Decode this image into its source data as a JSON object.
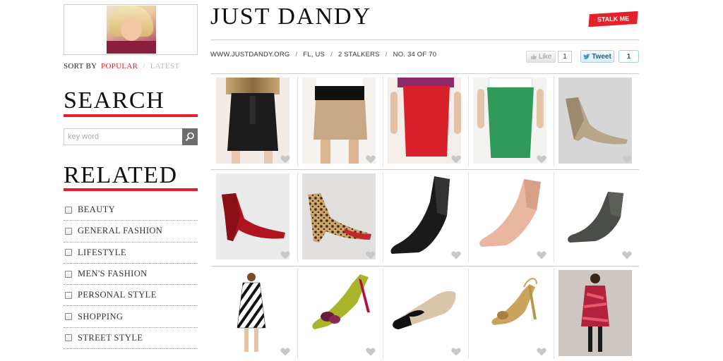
{
  "sidebar": {
    "sort_label": "SORT BY",
    "sort_popular": "POPULAR",
    "sort_sep": "/",
    "sort_latest": "LATEST",
    "search_heading": "SEARCH",
    "search_placeholder": "key word",
    "related_heading": "RELATED",
    "related_items": [
      "BEAUTY",
      "GENERAL FASHION",
      "LIFESTYLE",
      "MEN'S FASHION",
      "PERSONAL STYLE",
      "SHOPPING",
      "STREET STYLE"
    ]
  },
  "header": {
    "title": "JUST DANDY",
    "stalk_label": "STALK ME",
    "url": "WWW.JUSTDANDY.ORG",
    "location": "FL, US",
    "stalkers": "2 STALKERS",
    "rank": "NO. 34 OF 70",
    "separator": "/",
    "like_label": "Like",
    "like_count": "1",
    "tweet_label": "Tweet",
    "tweet_count": "1"
  },
  "colors": {
    "accent": "#e4202a",
    "tweet_blue": "#2a5a87"
  },
  "grid": {
    "items": [
      {
        "icon": "black-skirt",
        "heart": "heart-icon"
      },
      {
        "icon": "tan-leather-skirt",
        "heart": "heart-icon"
      },
      {
        "icon": "red-pencil-skirt",
        "heart": "heart-icon"
      },
      {
        "icon": "green-pencil-skirt",
        "heart": "heart-icon"
      },
      {
        "icon": "gold-wedge-shoe",
        "heart": "heart-icon"
      },
      {
        "icon": "red-suede-wedge",
        "heart": "heart-icon"
      },
      {
        "icon": "leopard-wedge",
        "heart": "heart-icon"
      },
      {
        "icon": "black-suede-wedge",
        "heart": "heart-icon"
      },
      {
        "icon": "nude-patent-wedge",
        "heart": "heart-icon"
      },
      {
        "icon": "grey-patent-wedge",
        "heart": "heart-icon"
      },
      {
        "icon": "zebra-dress",
        "heart": "heart-icon"
      },
      {
        "icon": "green-bow-pump",
        "heart": "heart-icon"
      },
      {
        "icon": "bow-flat",
        "heart": "heart-icon"
      },
      {
        "icon": "glitter-slingback",
        "heart": "heart-icon"
      },
      {
        "icon": "red-print-dress",
        "heart": "heart-icon"
      }
    ]
  }
}
